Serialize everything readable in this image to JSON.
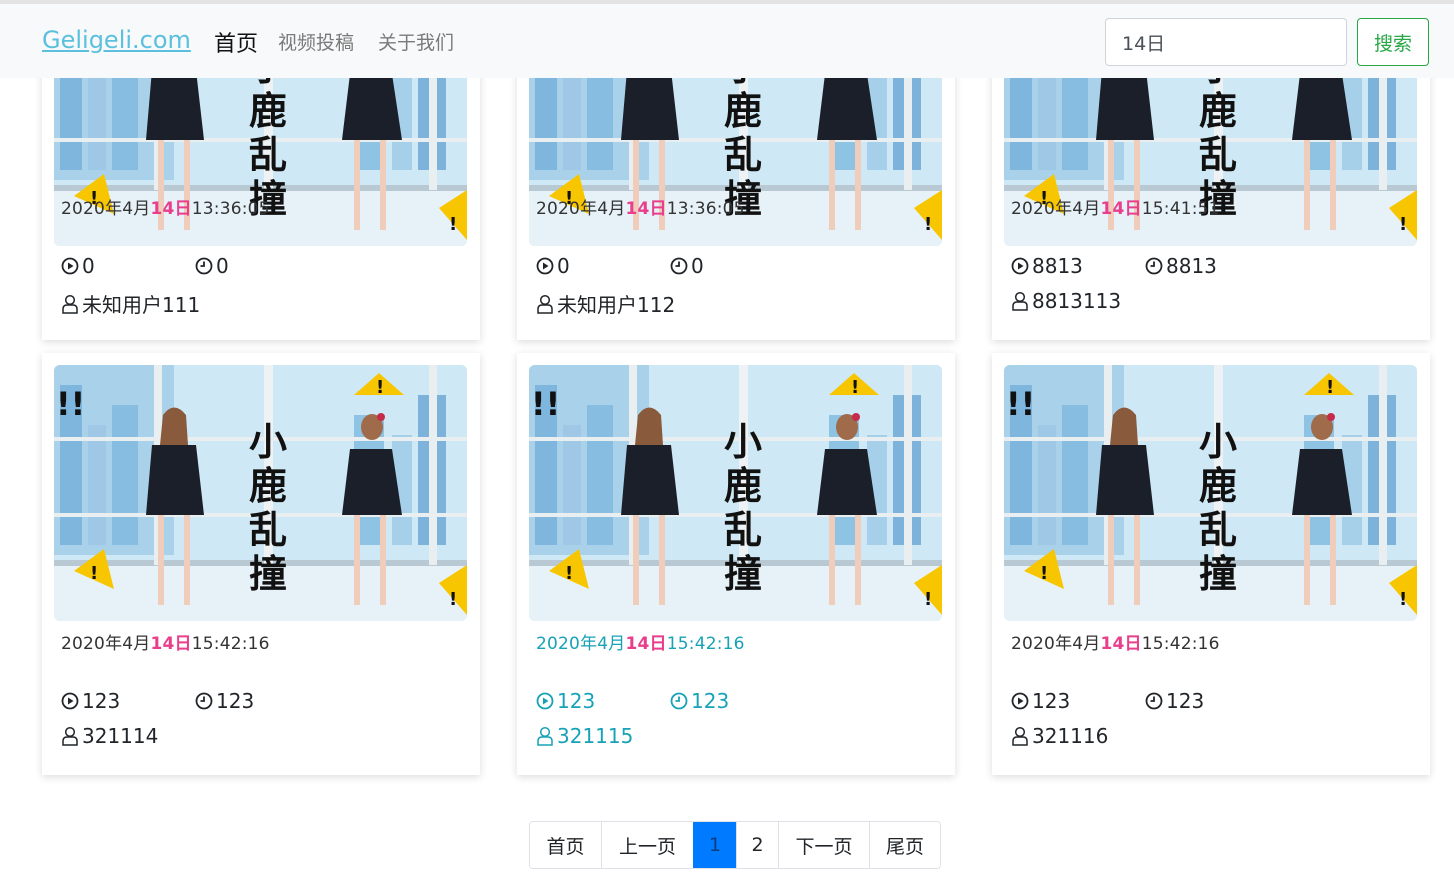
{
  "navbar": {
    "brand": "Geligeli.com",
    "links": [
      "首页",
      "视频投稿",
      "关于我们"
    ],
    "active_index": 0,
    "search_value": "14日",
    "search_button": "搜索",
    "colors": {
      "brand": "#5bc0de",
      "search_button": "#28a745"
    }
  },
  "thumbnail": {
    "caption_chars": [
      "小",
      "鹿",
      "乱",
      "撞"
    ],
    "exclaim": "!!"
  },
  "cards": [
    {
      "date_prefix": "2020年4月",
      "date_highlight": "14日",
      "date_suffix": "13:36:05",
      "plays": "0",
      "duration": "0",
      "user": "未知用户111"
    },
    {
      "date_prefix": "2020年4月",
      "date_highlight": "14日",
      "date_suffix": "13:36:05",
      "plays": "0",
      "duration": "0",
      "user": "未知用户112"
    },
    {
      "date_prefix": "2020年4月",
      "date_highlight": "14日",
      "date_suffix": "15:41:51",
      "plays": "8813",
      "duration": "8813",
      "user": "8813113"
    },
    {
      "date_prefix": "2020年4月",
      "date_highlight": "14日",
      "date_suffix": "15:42:16",
      "plays": "123",
      "duration": "123",
      "user": "321114"
    },
    {
      "date_prefix": "2020年4月",
      "date_highlight": "14日",
      "date_suffix": "15:42:16",
      "plays": "123",
      "duration": "123",
      "user": "321115",
      "hovered": true
    },
    {
      "date_prefix": "2020年4月",
      "date_highlight": "14日",
      "date_suffix": "15:42:16",
      "plays": "123",
      "duration": "123",
      "user": "321116"
    }
  ],
  "pagination": {
    "items": [
      "首页",
      "上一页",
      "1",
      "2",
      "下一页",
      "尾页"
    ],
    "active": "1",
    "active_color": "#007bff"
  },
  "colors": {
    "highlight": "#e83e8c",
    "hover": "#17a2b8"
  }
}
